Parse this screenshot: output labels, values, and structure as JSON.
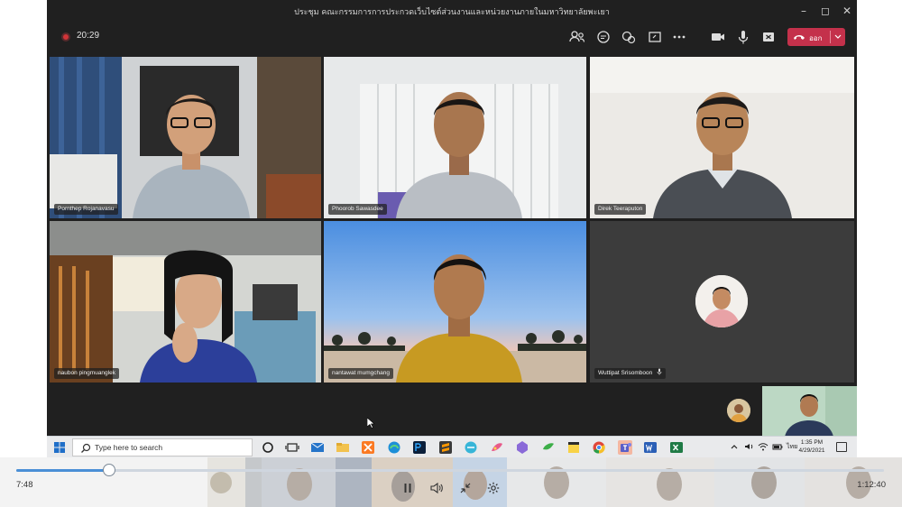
{
  "window": {
    "title": "ประชุม คณะกรรมการการประกวดเว็บไซต์ส่วนงานและหน่วยงานภายในมหาวิทยาลัยพะเยา"
  },
  "meeting": {
    "elapsed": "20:29",
    "leave_label": "ออก",
    "leave_color": "#c4314b",
    "record_color": "#d13438",
    "toolbar_icons": [
      "participants-icon",
      "chat-icon",
      "reactions-icon",
      "share-screen-icon",
      "more-options-icon",
      "camera-icon",
      "microphone-icon",
      "share-tray-icon"
    ]
  },
  "participants": [
    {
      "name": "Pornthep Rojanavasu"
    },
    {
      "name": "Phoorob Sawasdee"
    },
    {
      "name": "Direk Teeraputon"
    },
    {
      "name": "naubon pingmuanglek"
    },
    {
      "name": "nantawat mumgchang"
    },
    {
      "name": "Wuttipat Srisomboon"
    }
  ],
  "taskbar": {
    "search_placeholder": "Type here to search",
    "clock_time": "1:35 PM",
    "clock_date": "4/29/2021",
    "language": "ไทย"
  },
  "player": {
    "current_time": "7:48",
    "total_time": "1:12:40",
    "progress": 0.107
  }
}
